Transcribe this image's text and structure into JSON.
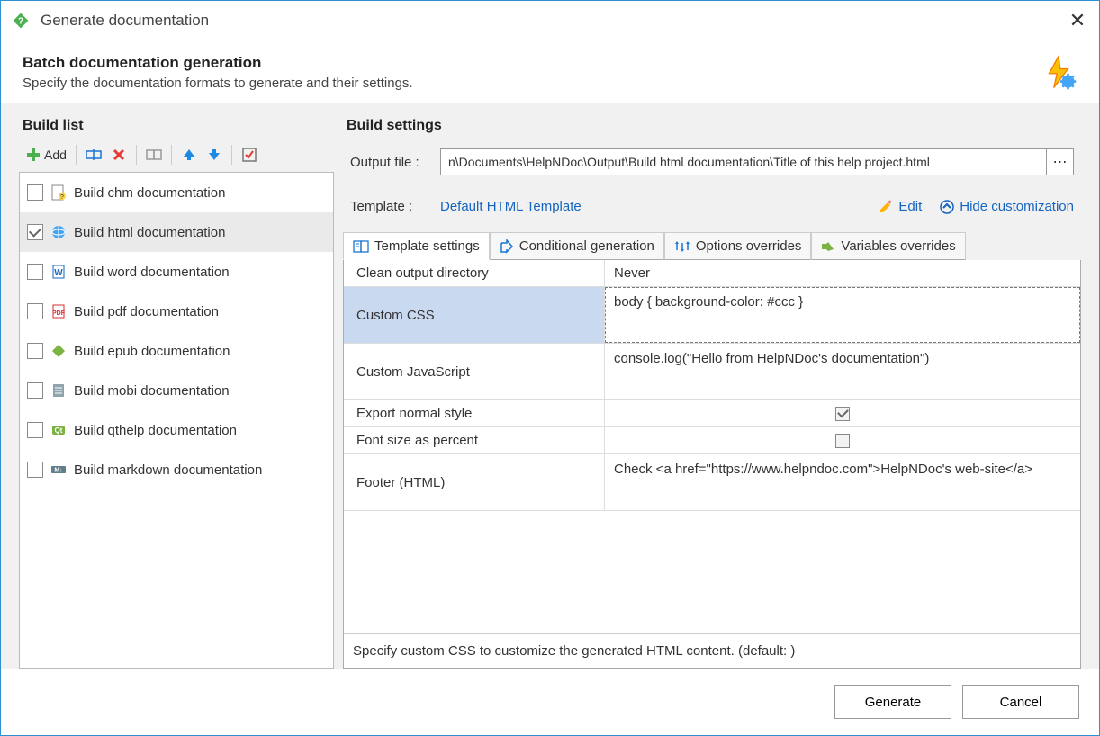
{
  "titlebar": {
    "title": "Generate documentation"
  },
  "banner": {
    "heading": "Batch documentation generation",
    "subheading": "Specify the documentation formats to generate and their settings."
  },
  "left": {
    "title": "Build list",
    "toolbar": {
      "add_label": "Add"
    },
    "items": [
      {
        "label": "Build chm documentation",
        "checked": false,
        "icon": "chm"
      },
      {
        "label": "Build html documentation",
        "checked": true,
        "icon": "html"
      },
      {
        "label": "Build word documentation",
        "checked": false,
        "icon": "word"
      },
      {
        "label": "Build pdf documentation",
        "checked": false,
        "icon": "pdf"
      },
      {
        "label": "Build epub documentation",
        "checked": false,
        "icon": "epub"
      },
      {
        "label": "Build mobi documentation",
        "checked": false,
        "icon": "mobi"
      },
      {
        "label": "Build qthelp documentation",
        "checked": false,
        "icon": "qt"
      },
      {
        "label": "Build markdown documentation",
        "checked": false,
        "icon": "md"
      }
    ]
  },
  "right": {
    "title": "Build settings",
    "output_label": "Output file :",
    "output_value": "n\\Documents\\HelpNDoc\\Output\\Build html documentation\\Title of this help project.html",
    "template_label": "Template :",
    "template_name": "Default HTML Template",
    "edit_label": "Edit",
    "hide_label": "Hide customization",
    "tabs": [
      {
        "label": "Template settings"
      },
      {
        "label": "Conditional generation"
      },
      {
        "label": "Options overrides"
      },
      {
        "label": "Variables overrides"
      }
    ],
    "settings": [
      {
        "key": "Clean output directory",
        "value": "Never",
        "type": "text"
      },
      {
        "key": "Custom CSS",
        "value": "body { background-color: #ccc }",
        "type": "text",
        "tall": true
      },
      {
        "key": "Custom JavaScript",
        "value": "console.log(\"Hello from HelpNDoc's documentation\")",
        "type": "text",
        "tall": true
      },
      {
        "key": "Export normal style",
        "value": true,
        "type": "check"
      },
      {
        "key": "Font size as percent",
        "value": false,
        "type": "check"
      },
      {
        "key": "Footer (HTML)",
        "value": "Check <a href=\"https://www.helpndoc.com\">HelpNDoc's web-site</a>",
        "type": "text",
        "tall": true
      }
    ],
    "hint": "Specify custom CSS to customize the generated HTML content. (default: )"
  },
  "footer": {
    "generate": "Generate",
    "cancel": "Cancel"
  }
}
